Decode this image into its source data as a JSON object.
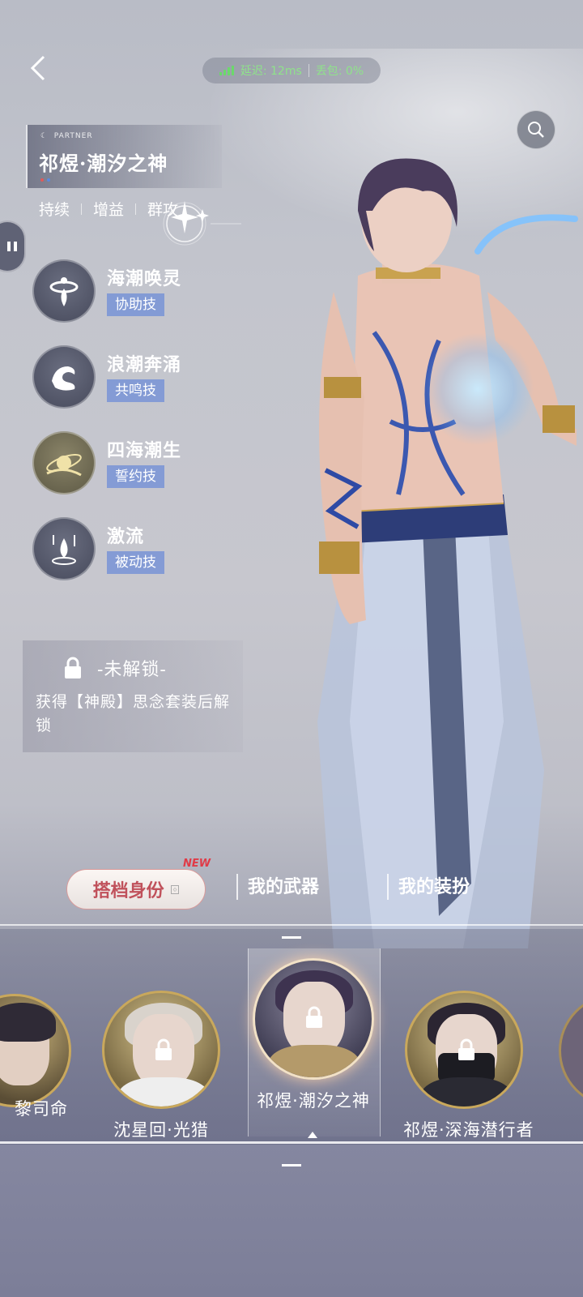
{
  "nav": {
    "back_icon": "chevron-left-icon",
    "search_icon": "search-icon"
  },
  "network": {
    "latency": "延迟: 12ms",
    "packet_loss": "丢包: 0%",
    "color": "#6bd96b"
  },
  "partner": {
    "tag": "PARTNER",
    "name": "祁煜·潮汐之神",
    "tags": [
      "持续",
      "增益",
      "群攻"
    ]
  },
  "skills": [
    {
      "name": "海潮唤灵",
      "type": "协助技",
      "icon": "whirlpool-icon"
    },
    {
      "name": "浪潮奔涌",
      "type": "共鸣技",
      "icon": "wave-icon"
    },
    {
      "name": "四海潮生",
      "type": "誓约技",
      "icon": "planet-icon"
    },
    {
      "name": "激流",
      "type": "被动技",
      "icon": "raindrop-icon"
    }
  ],
  "locked": {
    "title": "-未解锁-",
    "description": "获得【神殿】思念套装后解锁"
  },
  "tabs": {
    "identity": "搭档身份",
    "new_badge": "NEW",
    "weapon": "我的武器",
    "outfit": "我的装扮"
  },
  "characters": [
    {
      "name": "黎司命",
      "locked": false
    },
    {
      "name": "沈星回·光猎",
      "locked": true
    },
    {
      "name": "祁煜·潮汐之神",
      "locked": true,
      "selected": true
    },
    {
      "name": "祁煜·深海潜行者",
      "locked": true
    }
  ],
  "colors": {
    "accent_red": "#c0515b",
    "skill_tag": "#6e8cd7",
    "gold_ring": "#c9a85c"
  }
}
